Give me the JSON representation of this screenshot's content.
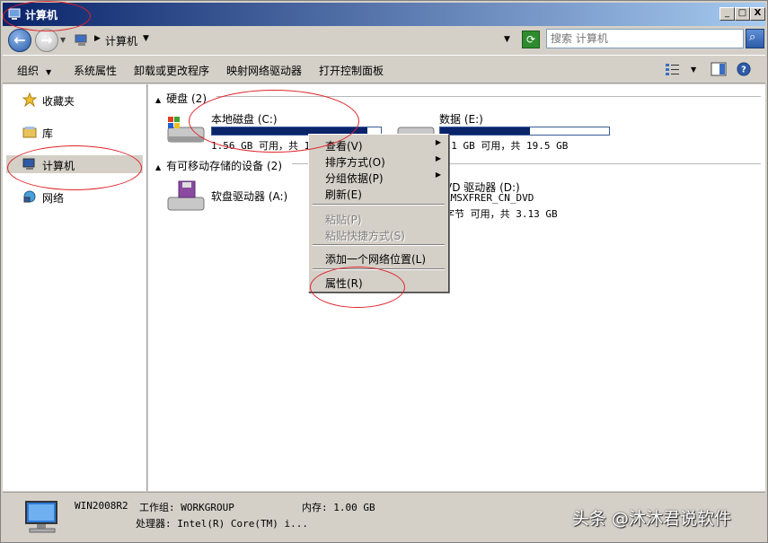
{
  "window": {
    "title": "计算机"
  },
  "titlebar_buttons": {
    "minimize": "_",
    "maximize": "□",
    "close": "X"
  },
  "address": {
    "location": "计算机",
    "search_placeholder": "搜索 计算机"
  },
  "toolbar": {
    "organize": "组织",
    "system_properties": "系统属性",
    "uninstall": "卸载或更改程序",
    "map_drive": "映射网络驱动器",
    "control_panel": "打开控制面板"
  },
  "nav": {
    "items": [
      {
        "label": "收藏夹",
        "icon": "star-icon"
      },
      {
        "label": "库",
        "icon": "library-icon"
      },
      {
        "label": "计算机",
        "icon": "computer-icon",
        "selected": true
      },
      {
        "label": "网络",
        "icon": "network-icon"
      }
    ]
  },
  "groups": {
    "hdd": {
      "title": "硬盘",
      "count": "(2)"
    },
    "removable": {
      "title": "有可移动存储的设备",
      "count": "(2)"
    }
  },
  "drives": {
    "c": {
      "name": "本地磁盘 (C:)",
      "info": "1.56 GB 可用，共 1",
      "used_fraction": 0.92
    },
    "e": {
      "name": "数据 (E:)",
      "info": "9.1 GB 可用，共 19.5 GB",
      "used_fraction": 0.53
    },
    "a": {
      "name": "软盘驱动器 (A:)"
    },
    "d": {
      "name": "VD 驱动器 (D:)",
      "label": "RMSXFRER_CN_DVD",
      "info": "字节 可用，共 3.13 GB"
    }
  },
  "context_menu": {
    "view": "查看(V)",
    "sort": "排序方式(O)",
    "group": "分组依据(P)",
    "refresh": "刷新(E)",
    "paste": "粘贴(P)",
    "paste_shortcut": "粘贴快捷方式(S)",
    "add_network_location": "添加一个网络位置(L)",
    "properties": "属性(R)"
  },
  "status": {
    "computer_name": "WIN2008R2",
    "workgroup": "工作组: WORKGROUP",
    "memory": "内存: 1.00 GB",
    "processor": "处理器: Intel(R) Core(TM) i..."
  },
  "watermark": "头条 @沐沐君说软件",
  "colors": {
    "title_gradient_start": "#0a246a",
    "title_gradient_end": "#a6caf0",
    "annotation": "#e0242b",
    "drive_fill": "#0a246a"
  }
}
